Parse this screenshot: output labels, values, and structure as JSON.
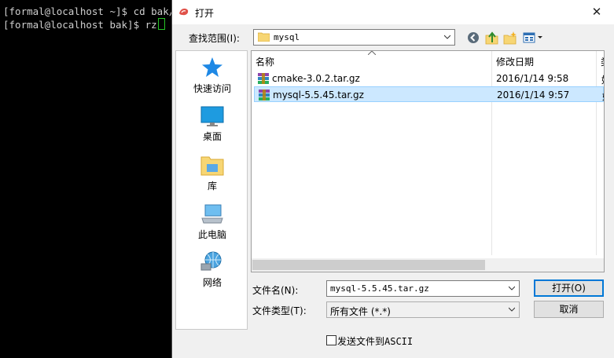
{
  "terminal": {
    "lines": [
      "[formal@localhost ~]$ cd bak/",
      "[formal@localhost bak]$ rz"
    ]
  },
  "dialog": {
    "title": "打开",
    "close_glyph": "✕",
    "look_in_label": "查找范围(I):",
    "look_in_value": "mysql",
    "places": [
      {
        "label": "快速访问",
        "icon": "star-icon"
      },
      {
        "label": "桌面",
        "icon": "desktop-icon"
      },
      {
        "label": "库",
        "icon": "library-icon"
      },
      {
        "label": "此电脑",
        "icon": "computer-icon"
      },
      {
        "label": "网络",
        "icon": "network-icon"
      }
    ],
    "columns": {
      "name": "名称",
      "date": "修改日期",
      "type": "类"
    },
    "files": [
      {
        "name": "cmake-3.0.2.tar.gz",
        "date": "2016/1/14 9:58",
        "type": "好",
        "selected": false,
        "icon": "winrar-archive-icon"
      },
      {
        "name": "mysql-5.5.45.tar.gz",
        "date": "2016/1/14 9:57",
        "type": "好",
        "selected": true,
        "icon": "winrar-archive-icon"
      }
    ],
    "file_name_label": "文件名(N):",
    "file_name_value": "mysql-5.5.45.tar.gz",
    "file_type_label": "文件类型(T):",
    "file_type_value": "所有文件 (*.*)",
    "open_button": "打开(O)",
    "cancel_button": "取消",
    "ascii_checkbox_label": "发送文件到ASCII",
    "ascii_checked": false
  },
  "colors": {
    "accent": "#0078d7",
    "selection": "#cce8ff",
    "terminal_bg": "#000000",
    "terminal_fg": "#cfcfcf",
    "cursor": "#25c425"
  }
}
